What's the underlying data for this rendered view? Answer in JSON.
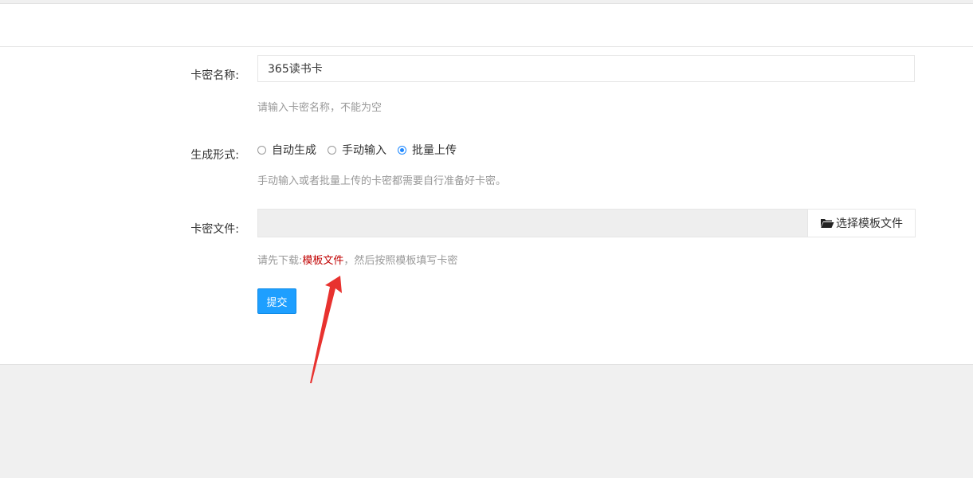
{
  "form": {
    "card_name": {
      "label": "卡密名称:",
      "value": "365读书卡",
      "hint": "请输入卡密名称，不能为空"
    },
    "generate_mode": {
      "label": "生成形式:",
      "options": [
        {
          "label": "自动生成",
          "checked": false
        },
        {
          "label": "手动输入",
          "checked": false
        },
        {
          "label": "批量上传",
          "checked": true
        }
      ],
      "hint": "手动输入或者批量上传的卡密都需要自行准备好卡密。"
    },
    "card_file": {
      "label": "卡密文件:",
      "button_label": "选择模板文件",
      "hint_prefix": "请先下载:",
      "hint_link": "模板文件",
      "hint_suffix": "，然后按照模板填写卡密"
    },
    "submit_label": "提交"
  },
  "colors": {
    "accent": "#1e9fff",
    "link_red": "#c00000",
    "annotation_arrow": "#e8322f"
  },
  "icons": {
    "file_button_icon": "folder-open-icon"
  }
}
